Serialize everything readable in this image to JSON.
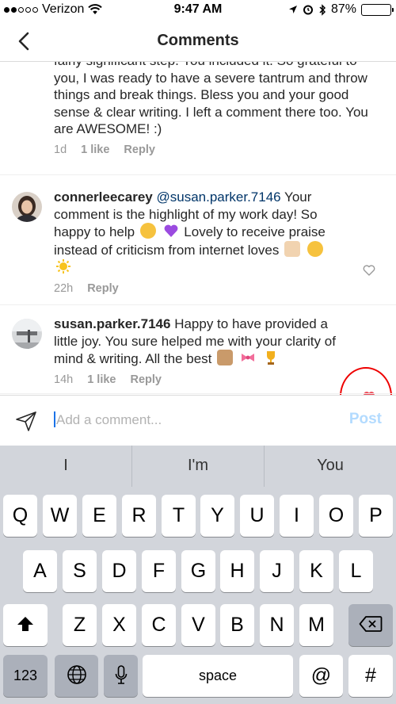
{
  "status_bar": {
    "carrier": "Verizon",
    "time": "9:47 AM",
    "battery": "87%",
    "battery_level": 0.87
  },
  "nav": {
    "back_icon": "chevron-left-icon",
    "title": "Comments"
  },
  "comments": [
    {
      "text": "fairly significant step. You included it. So grateful to you, I was ready to have a severe tantrum and throw things and break things. Bless you and your good sense & clear writing. I left a comment there too. You are AWESOME! :)",
      "time": "1d",
      "likes": "1 like",
      "reply": "Reply"
    },
    {
      "username": "connerleecarey",
      "mention": "@susan.parker.7146",
      "text_part1": "Your comment is the highlight of my work day! So happy to help",
      "text_part2": "Lovely to receive praise instead of criticism from internet loves",
      "time": "22h",
      "reply": "Reply",
      "liked": false
    },
    {
      "username": "susan.parker.7146",
      "text": "Happy to have provided a little joy. You sure helped me with your clarity of mind & writing. All the best",
      "time": "14h",
      "likes": "1 like",
      "reply": "Reply",
      "liked": true
    }
  ],
  "composer": {
    "placeholder": "Add a comment...",
    "post_label": "Post"
  },
  "keyboard": {
    "suggestions": [
      "I",
      "I'm",
      "You"
    ],
    "row1": [
      "Q",
      "W",
      "E",
      "R",
      "T",
      "Y",
      "U",
      "I",
      "O",
      "P"
    ],
    "row2": [
      "A",
      "S",
      "D",
      "F",
      "G",
      "H",
      "J",
      "K",
      "L"
    ],
    "row3": [
      "Z",
      "X",
      "C",
      "V",
      "B",
      "N",
      "M"
    ],
    "numbers_label": "123",
    "space_label": "space",
    "at_label": "@",
    "hash_label": "#"
  },
  "colors": {
    "heart_liked": "#ed4956",
    "highlight_circle": "#e00000",
    "post_disabled": "#b3dbff",
    "mention": "#003569"
  }
}
